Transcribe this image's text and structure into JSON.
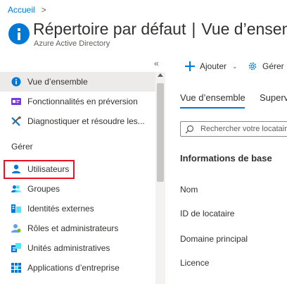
{
  "breadcrumb": {
    "items": [
      "Accueil"
    ],
    "separator": ">"
  },
  "header": {
    "title": "Répertoire par défaut",
    "divider": "|",
    "section": "Vue d’ensemble",
    "subtitle": "Azure Active Directory"
  },
  "sidebar": {
    "collapse_glyph": "«",
    "items_top": [
      {
        "label": "Vue d’ensemble",
        "icon": "info-icon",
        "active": true
      },
      {
        "label": "Fonctionnalités en préversion",
        "icon": "preview-icon"
      },
      {
        "label": "Diagnostiquer et résoudre les...",
        "icon": "tools-icon"
      }
    ],
    "group_label": "Gérer",
    "items_manage": [
      {
        "label": "Utilisateurs",
        "icon": "user-icon",
        "highlighted": true
      },
      {
        "label": "Groupes",
        "icon": "group-icon"
      },
      {
        "label": "Identités externes",
        "icon": "external-identities-icon"
      },
      {
        "label": "Rôles et administrateurs",
        "icon": "roles-icon"
      },
      {
        "label": "Unités administratives",
        "icon": "admin-units-icon"
      },
      {
        "label": "Applications d’entreprise",
        "icon": "enterprise-apps-icon"
      }
    ]
  },
  "toolbar": {
    "add_label": "Ajouter",
    "manage_label": "Gérer"
  },
  "tabs": [
    "Vue d’ensemble",
    "Superv"
  ],
  "search": {
    "placeholder": "Rechercher votre locataire"
  },
  "main": {
    "section_title": "Informations de base",
    "properties": [
      "Nom",
      "ID de locataire",
      "Domaine principal",
      "Licence"
    ]
  },
  "colors": {
    "accent": "#0078d4",
    "highlight": "#e81123",
    "active_bg": "#edebe9"
  }
}
